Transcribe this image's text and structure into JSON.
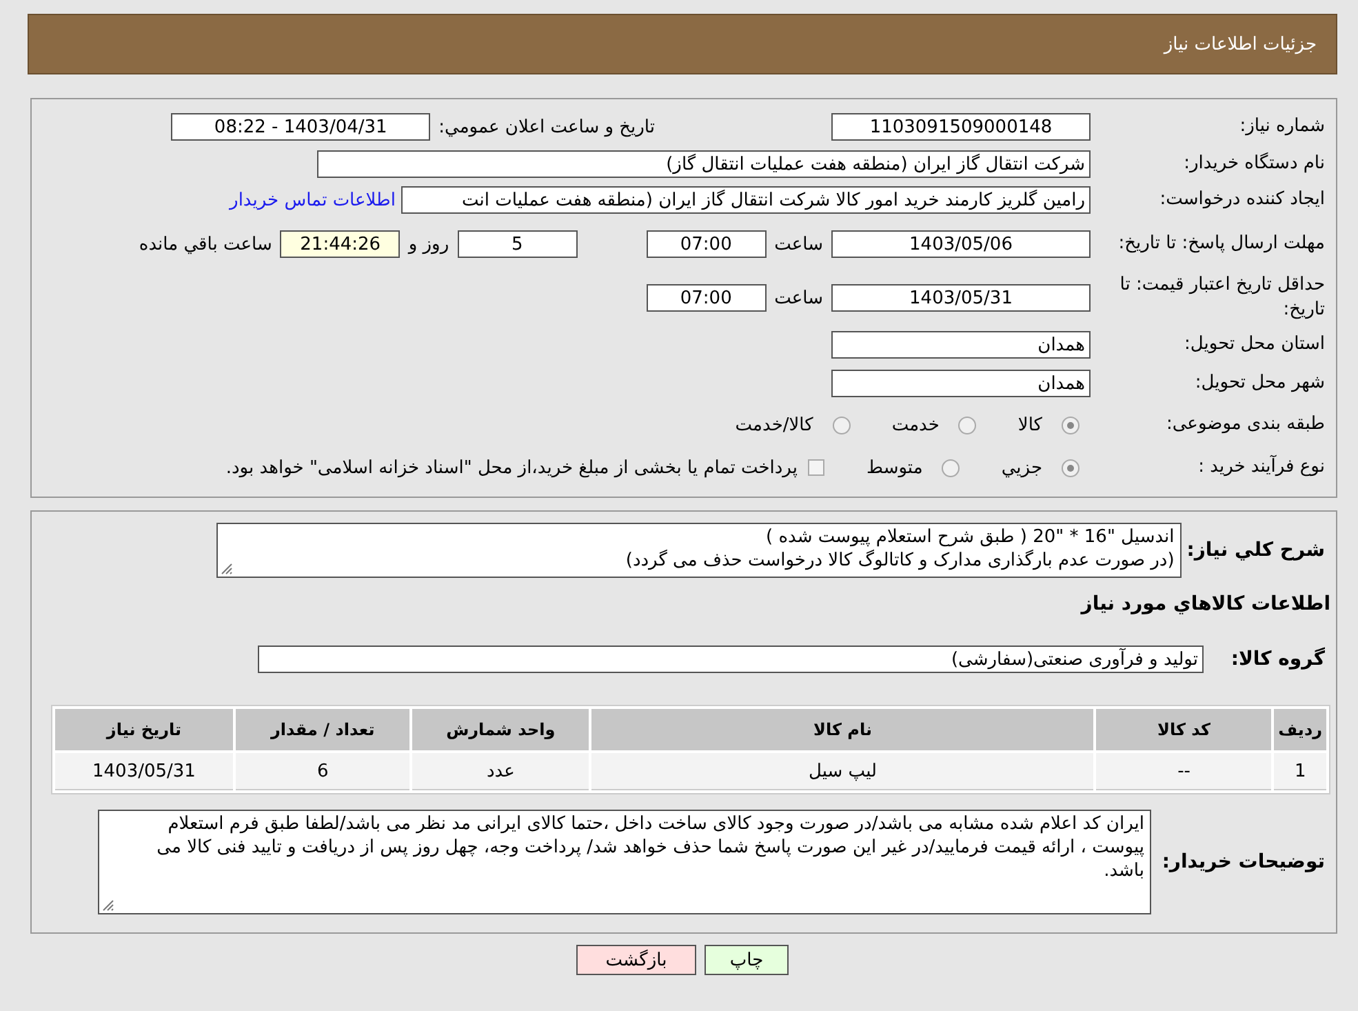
{
  "header": {
    "title": "جزئيات اطلاعات نياز"
  },
  "details": {
    "need_number": {
      "label": "شماره نياز:",
      "value": "1103091509000148"
    },
    "announce": {
      "label": "تاريخ و ساعت اعلان عمومي:",
      "value": "1403/04/31 - 08:22"
    },
    "buyer": {
      "label": "نام دستگاه خريدار:",
      "value": "شرکت انتقال گاز ايران (منطقه هفت عمليات انتقال گاز)"
    },
    "creator": {
      "label": "ايجاد کننده درخواست:",
      "value": "رامين گلريز کارمند خريد امور کالا شرکت انتقال گاز ايران (منطقه هفت عمليات انت",
      "link": "اطلاعات تماس خريدار"
    },
    "deadline": {
      "label": "مهلت ارسال پاسخ: تا تاريخ:",
      "date": "1403/05/06",
      "time_label": "ساعت",
      "time": "07:00",
      "days": "5",
      "days_label": "روز و",
      "remaining": "21:44:26",
      "remaining_label": "ساعت باقي مانده"
    },
    "validity": {
      "label": "حداقل تاريخ اعتبار قيمت: تا تاريخ:",
      "date": "1403/05/31",
      "time_label": "ساعت",
      "time": "07:00"
    },
    "province": {
      "label": "استان محل تحويل:",
      "value": "همدان"
    },
    "city": {
      "label": "شهر محل تحويل:",
      "value": "همدان"
    },
    "category": {
      "label": "طبقه بندی موضوعی:",
      "options": [
        {
          "label": "کالا",
          "selected": true
        },
        {
          "label": "خدمت",
          "selected": false
        },
        {
          "label": "کالا/خدمت",
          "selected": false
        }
      ]
    },
    "process": {
      "label": "نوع فرآيند خريد :",
      "options": [
        {
          "label": "جزيي",
          "selected": true
        },
        {
          "label": "متوسط",
          "selected": false
        }
      ],
      "payment": {
        "checked": false,
        "text": "پرداخت تمام يا بخشی از مبلغ خريد،از محل \"اسناد خزانه اسلامی\" خواهد بود."
      }
    }
  },
  "needs": {
    "description": {
      "label": "شرح كلي نياز:",
      "lines": [
        "اندسيل \"16 * \"20 ( طبق شرح استعلام پيوست شده )",
        "(در صورت عدم بارگذاری مدارک و کاتالوگ کالا درخواست حذف می گردد)"
      ]
    },
    "goods_heading": "اطلاعات كالاهاي مورد نياز",
    "group": {
      "label": "گروه كالا:",
      "value": "توليد و فرآوری صنعتی(سفارشی)"
    },
    "table": {
      "columns": [
        "رديف",
        "کد کالا",
        "نام کالا",
        "واحد شمارش",
        "تعداد / مقدار",
        "تاريخ نياز"
      ],
      "rows": [
        [
          "1",
          "--",
          "ليپ سيل",
          "عدد",
          "6",
          "1403/05/31"
        ]
      ]
    },
    "notes": {
      "label": "توضيحات خريدار:",
      "value": "ايران کد اعلام شده مشابه می باشد/در صورت وجود کالای ساخت داخل ،حتما کالای ايرانی مد نظر می باشد/لطفا طبق فرم استعلام پيوست ، ارائه قيمت فرماييد/در غير اين صورت پاسخ شما حذف خواهد شد/ پرداخت وجه، چهل روز پس از دريافت و تاييد فنی کالا می باشد."
    }
  },
  "buttons": [
    {
      "kind": "print",
      "label": "چاپ"
    },
    {
      "kind": "back",
      "label": "بازگشت"
    }
  ]
}
